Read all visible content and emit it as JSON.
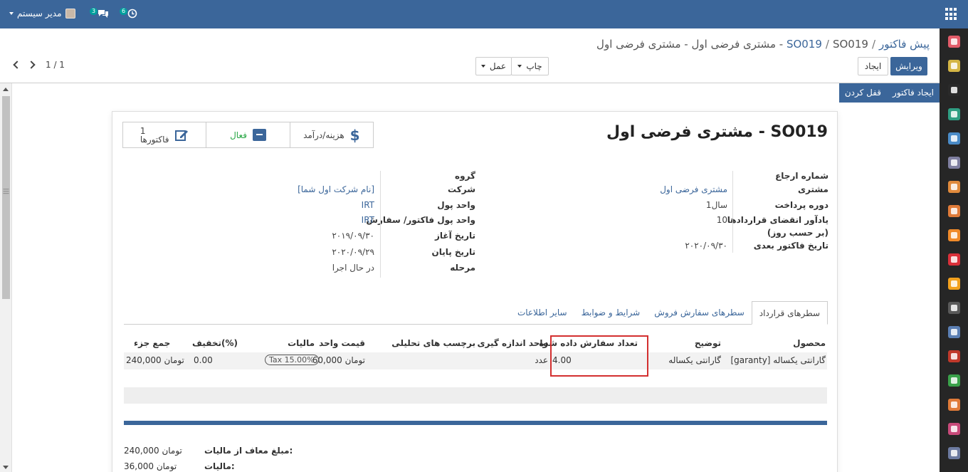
{
  "topbar": {
    "user_name": "مدیر سیستم",
    "messages_count": "3",
    "activities_count": "6"
  },
  "breadcrumb": {
    "root": "پیش فاکتور",
    "parent": "SO019",
    "current": "SO019 - مشتری فرضی اول - مشتری فرضی اول"
  },
  "toolbar": {
    "edit_label": "ویرایش",
    "create_label": "ایجاد",
    "print_label": "چاپ",
    "action_label": "عمل",
    "pager": "1 / 1"
  },
  "status_buttons": {
    "create_invoice": "ایجاد فاکتور",
    "lock": "قفل کردن"
  },
  "smart_buttons": {
    "cost_revenue": "هزینه/درآمد",
    "active": "فعال",
    "invoices_count": "1",
    "invoices_label": "فاکتورها"
  },
  "record": {
    "title": "SO019 - مشتری فرضی اول"
  },
  "left_group": {
    "labels": {
      "reference": "شماره ارجاع",
      "customer": "مشتری",
      "payment_period": "دوره پرداخت",
      "reminder_line1": "یادآور انقضای قراردادها",
      "reminder_line2": "(بر حسب روز)",
      "next_invoice": "تاریخ فاکتور بعدی"
    },
    "values": {
      "customer": "مشتری فرضی اول",
      "payment_period": "1سال",
      "reminder": "10",
      "next_invoice": "۲۰۲۰/۰۹/۳۰"
    }
  },
  "right_group": {
    "labels": {
      "group": "گروه",
      "company": "شرکت",
      "currency": "واحد پول",
      "invoice_currency": "واحد پول فاکتور/ سفارش",
      "start_date": "تاریخ آغاز",
      "end_date": "تاریخ پایان",
      "stage": "مرحله"
    },
    "values": {
      "company": "[نام شرکت اول شما]",
      "currency": "IRT",
      "invoice_currency": "IRT",
      "start_date": "۲۰۱۹/۰۹/۳۰",
      "end_date": "۲۰۲۰/۰۹/۲۹",
      "stage": "در حال اجرا"
    }
  },
  "tabs": [
    "سطرهای قرارداد",
    "سطرهای سفارش فروش",
    "شرایط و ضوابط",
    "سایر اطلاعات"
  ],
  "table": {
    "headers": {
      "product": "محصول",
      "description": "توضیح",
      "ordered_qty": "تعداد سفارش داده شده",
      "uom": "واحد اندازه گیری",
      "analytic_tags": "برچسب های تحلیلی",
      "unit_price": "قیمت واحد",
      "taxes": "مالیات",
      "discount": "تخفیف(%)",
      "subtotal": "جمع جزء"
    },
    "rows": [
      {
        "product": "[garanty] گارانتی یکساله",
        "description": "گارانتی یکساله",
        "ordered_qty": "4.00",
        "uom": "عدد",
        "analytic_tags": "",
        "unit_price": "60,000 تومان",
        "tax": "Tax 15.00%",
        "discount": "0.00",
        "subtotal": "240,000 تومان"
      }
    ]
  },
  "totals": {
    "untaxed_label": "مبلغ معاف از مالیات:",
    "untaxed_value": "240,000 تومان",
    "tax_label": "مالیات:",
    "tax_value": "36,000 تومان"
  },
  "colors": {
    "brand": "#3b669a",
    "sidebar": "#262626",
    "highlight": "#d32f2f"
  },
  "sidebar_apps": [
    {
      "name": "discuss",
      "color": "#e25c6a"
    },
    {
      "name": "calendar",
      "color": "#d4b545"
    },
    {
      "name": "notes",
      "color": "#2a2a2a"
    },
    {
      "name": "contracts",
      "color": "#2f9e83"
    },
    {
      "name": "settings",
      "color": "#4a8bc7"
    },
    {
      "name": "crm",
      "color": "#7f7fa0"
    },
    {
      "name": "dashboard",
      "color": "#e08a3c"
    },
    {
      "name": "website",
      "color": "#e07b39"
    },
    {
      "name": "sales",
      "color": "#ef8a2a"
    },
    {
      "name": "documents",
      "color": "#d9303a"
    },
    {
      "name": "helpdesk",
      "color": "#f2a11e"
    },
    {
      "name": "inventory",
      "color": "#5a5a5a"
    },
    {
      "name": "accounting",
      "color": "#5b7fb3"
    },
    {
      "name": "gifts",
      "color": "#c0392b"
    },
    {
      "name": "tools",
      "color": "#3aa14a"
    },
    {
      "name": "reports",
      "color": "#e07b39"
    },
    {
      "name": "employees",
      "color": "#c84a7a"
    },
    {
      "name": "apps",
      "color": "#6c7aa0"
    }
  ]
}
